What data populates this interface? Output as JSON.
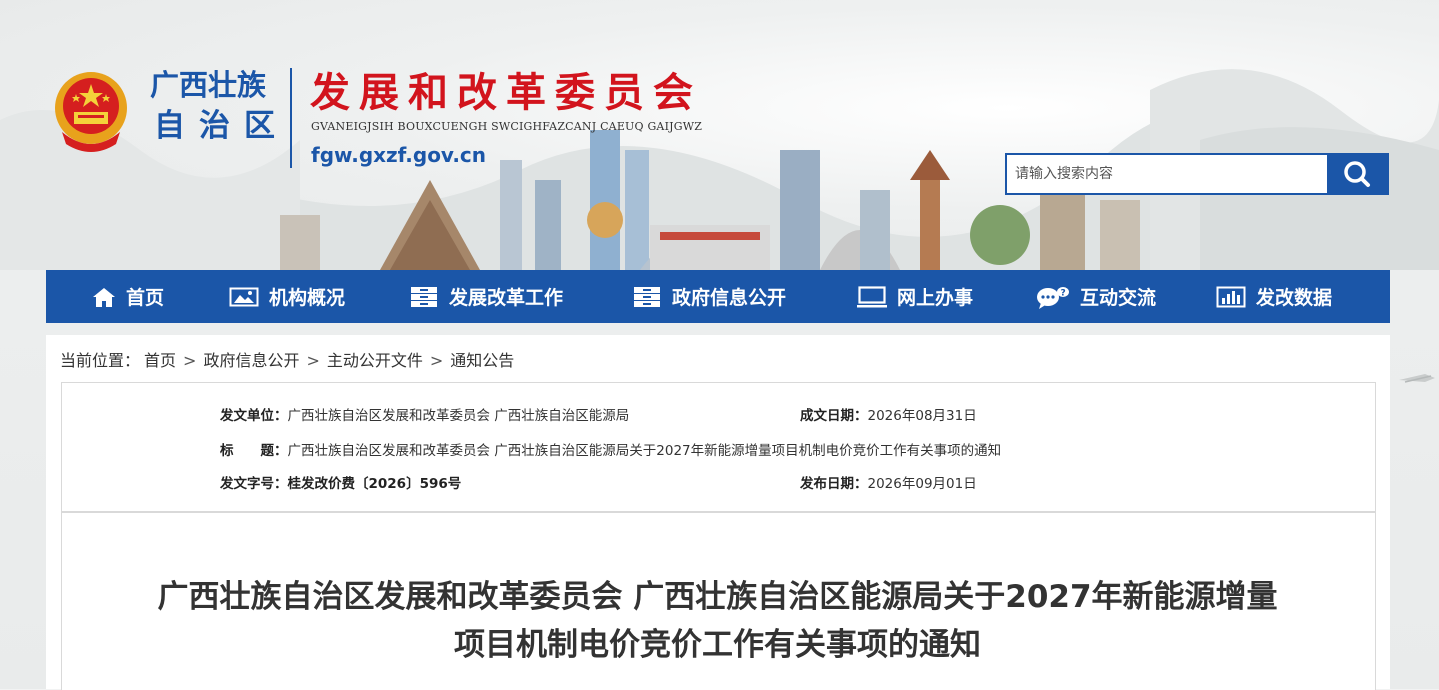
{
  "header": {
    "region_line1": "广西壮族",
    "region_line2": "自治区",
    "org_title": "发展和改革委员会",
    "org_subtitle": "GVANEIGJSIH BOUXCUENGH SWCIGHFAZCANJ CAEUQ GAIJGWZ",
    "url": "fgw.gxzf.gov.cn"
  },
  "search": {
    "placeholder": "请输入搜索内容",
    "value": ""
  },
  "nav": {
    "items": [
      {
        "label": "首页",
        "icon": "home-icon"
      },
      {
        "label": "机构概况",
        "icon": "image-icon"
      },
      {
        "label": "发展改革工作",
        "icon": "cabinet-icon"
      },
      {
        "label": "政府信息公开",
        "icon": "cabinet-icon"
      },
      {
        "label": "网上办事",
        "icon": "monitor-icon"
      },
      {
        "label": "互动交流",
        "icon": "chat-icon"
      },
      {
        "label": "发改数据",
        "icon": "bar-chart-icon"
      }
    ]
  },
  "breadcrumb": {
    "prefix": "当前位置：",
    "items": [
      "首页",
      "政府信息公开",
      "主动公开文件",
      "通知公告"
    ],
    "separator": ">"
  },
  "meta": {
    "issuer_label": "发文单位：",
    "issuer": "广西壮族自治区发展和改革委员会 广西壮族自治区能源局",
    "created_label": "成文日期：",
    "created": "2026年08月31日",
    "title_label": "标　　题：",
    "title": "广西壮族自治区发展和改革委员会 广西壮族自治区能源局关于2027年新能源增量项目机制电价竞价工作有关事项的通知",
    "docno_label": "发文字号：",
    "docno": "桂发改价费〔2026〕596号",
    "published_label": "发布日期：",
    "published": "2026年09月01日"
  },
  "document": {
    "title_line1": "广西壮族自治区发展和改革委员会 广西壮族自治区能源局关于2027年新能源增量",
    "title_line2": "项目机制电价竞价工作有关事项的通知"
  },
  "colors": {
    "primary_blue": "#1b56a8",
    "title_red": "#d2141d"
  }
}
